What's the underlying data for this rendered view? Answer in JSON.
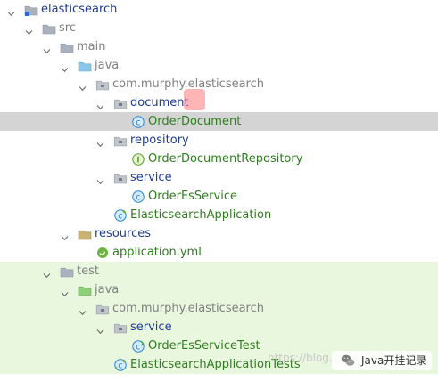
{
  "tree": {
    "rows": [
      {
        "name": "project-root",
        "label": "elasticsearch",
        "indent": 0,
        "expanded": true,
        "icon": "folder-module-icon",
        "color": "blue"
      },
      {
        "name": "src-folder",
        "label": "src",
        "indent": 1,
        "expanded": true,
        "icon": "folder-icon",
        "color": "gray"
      },
      {
        "name": "main-folder",
        "label": "main",
        "indent": 2,
        "expanded": true,
        "icon": "folder-icon",
        "color": "gray"
      },
      {
        "name": "java-folder",
        "label": "java",
        "indent": 3,
        "expanded": true,
        "icon": "source-folder-icon",
        "color": "gray"
      },
      {
        "name": "package-main",
        "label": "com.murphy.elasticsearch",
        "indent": 4,
        "expanded": true,
        "icon": "package-icon",
        "color": "gray"
      },
      {
        "name": "document-package",
        "label": "document",
        "indent": 5,
        "expanded": true,
        "icon": "package-icon",
        "color": "blue"
      },
      {
        "name": "order-document-class",
        "label": "OrderDocument",
        "indent": 6,
        "expanded": null,
        "icon": "class-icon",
        "color": "green",
        "selected": true
      },
      {
        "name": "repository-package",
        "label": "repository",
        "indent": 5,
        "expanded": true,
        "icon": "package-icon",
        "color": "blue"
      },
      {
        "name": "order-document-repository-interface",
        "label": "OrderDocumentRepository",
        "indent": 6,
        "expanded": null,
        "icon": "interface-icon",
        "color": "green"
      },
      {
        "name": "service-package",
        "label": "service",
        "indent": 5,
        "expanded": true,
        "icon": "package-icon",
        "color": "blue"
      },
      {
        "name": "order-es-service-class",
        "label": "OrderEsService",
        "indent": 6,
        "expanded": null,
        "icon": "class-icon",
        "color": "green"
      },
      {
        "name": "elasticsearch-application-class",
        "label": "ElasticsearchApplication",
        "indent": 5,
        "expanded": null,
        "icon": "spring-boot-class-icon",
        "color": "green"
      },
      {
        "name": "resources-folder",
        "label": "resources",
        "indent": 3,
        "expanded": true,
        "icon": "resources-folder-icon",
        "color": "blue"
      },
      {
        "name": "application-yml-file",
        "label": "application.yml",
        "indent": 4,
        "expanded": null,
        "icon": "spring-yml-icon",
        "color": "green"
      },
      {
        "name": "test-folder",
        "label": "test",
        "indent": 2,
        "expanded": true,
        "icon": "folder-icon",
        "color": "gray",
        "test": true
      },
      {
        "name": "test-java-folder",
        "label": "java",
        "indent": 3,
        "expanded": true,
        "icon": "test-source-folder-icon",
        "color": "gray",
        "test": true
      },
      {
        "name": "test-package",
        "label": "com.murphy.elasticsearch",
        "indent": 4,
        "expanded": true,
        "icon": "package-icon",
        "color": "gray",
        "test": true
      },
      {
        "name": "test-service-package",
        "label": "service",
        "indent": 5,
        "expanded": true,
        "icon": "package-icon",
        "color": "blue",
        "test": true
      },
      {
        "name": "order-es-service-test-class",
        "label": "OrderEsServiceTest",
        "indent": 6,
        "expanded": null,
        "icon": "test-class-icon",
        "color": "green",
        "test": true
      },
      {
        "name": "elasticsearch-application-tests-class",
        "label": "ElasticsearchApplicationTests",
        "indent": 5,
        "expanded": null,
        "icon": "spring-boot-test-class-icon",
        "color": "green",
        "test": true
      }
    ]
  },
  "watermark": {
    "text": "https://blog.csdn.net/...",
    "badge_text": "Java开挂记录"
  },
  "colors": {
    "selected_row": "#d4d4d4",
    "test_row": "#eaf7df",
    "blue_text": "#1f3b8f",
    "green_text": "#2f7d20",
    "gray_text": "#808080"
  }
}
